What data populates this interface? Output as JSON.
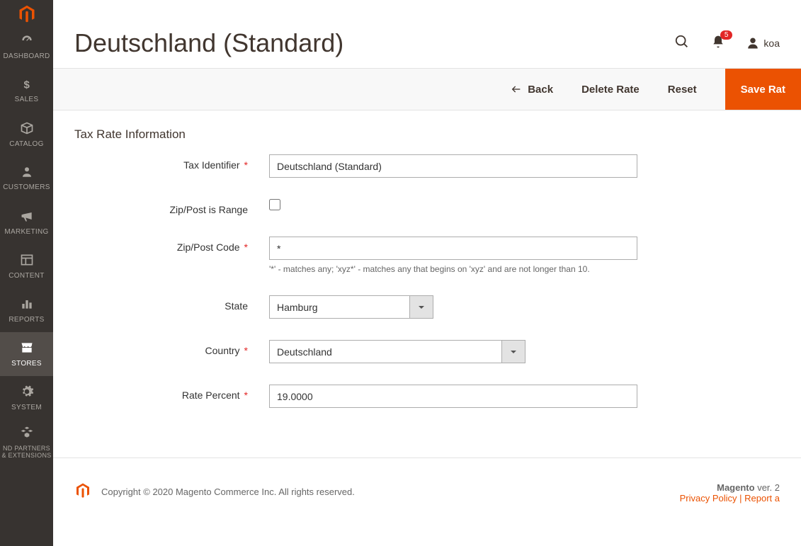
{
  "sidebar": {
    "items": [
      {
        "label": "DASHBOARD"
      },
      {
        "label": "SALES"
      },
      {
        "label": "CATALOG"
      },
      {
        "label": "CUSTOMERS"
      },
      {
        "label": "MARKETING"
      },
      {
        "label": "CONTENT"
      },
      {
        "label": "REPORTS"
      },
      {
        "label": "STORES"
      },
      {
        "label": "SYSTEM"
      },
      {
        "label": "ND PARTNERS & EXTENSIONS"
      }
    ]
  },
  "header": {
    "title": "Deutschland (Standard)",
    "notification_count": "5",
    "username": "koa"
  },
  "actions": {
    "back": "Back",
    "delete": "Delete Rate",
    "reset": "Reset",
    "save": "Save Rat"
  },
  "section": {
    "title": "Tax Rate Information",
    "fields": {
      "tax_identifier": {
        "label": "Tax Identifier",
        "value": "Deutschland (Standard)",
        "required": true
      },
      "zip_is_range": {
        "label": "Zip/Post is Range",
        "checked": false
      },
      "zip_code": {
        "label": "Zip/Post Code",
        "value": "*",
        "required": true,
        "help": "'*' - matches any; 'xyz*' - matches any that begins on 'xyz' and are not longer than 10."
      },
      "state": {
        "label": "State",
        "value": "Hamburg"
      },
      "country": {
        "label": "Country",
        "value": "Deutschland",
        "required": true
      },
      "rate_percent": {
        "label": "Rate Percent",
        "value": "19.0000",
        "required": true
      }
    }
  },
  "footer": {
    "copyright": "Copyright © 2020 Magento Commerce Inc. All rights reserved.",
    "brand": "Magento",
    "version": " ver. 2",
    "links": "Privacy Policy  |  Report a"
  },
  "required_marker": "*"
}
